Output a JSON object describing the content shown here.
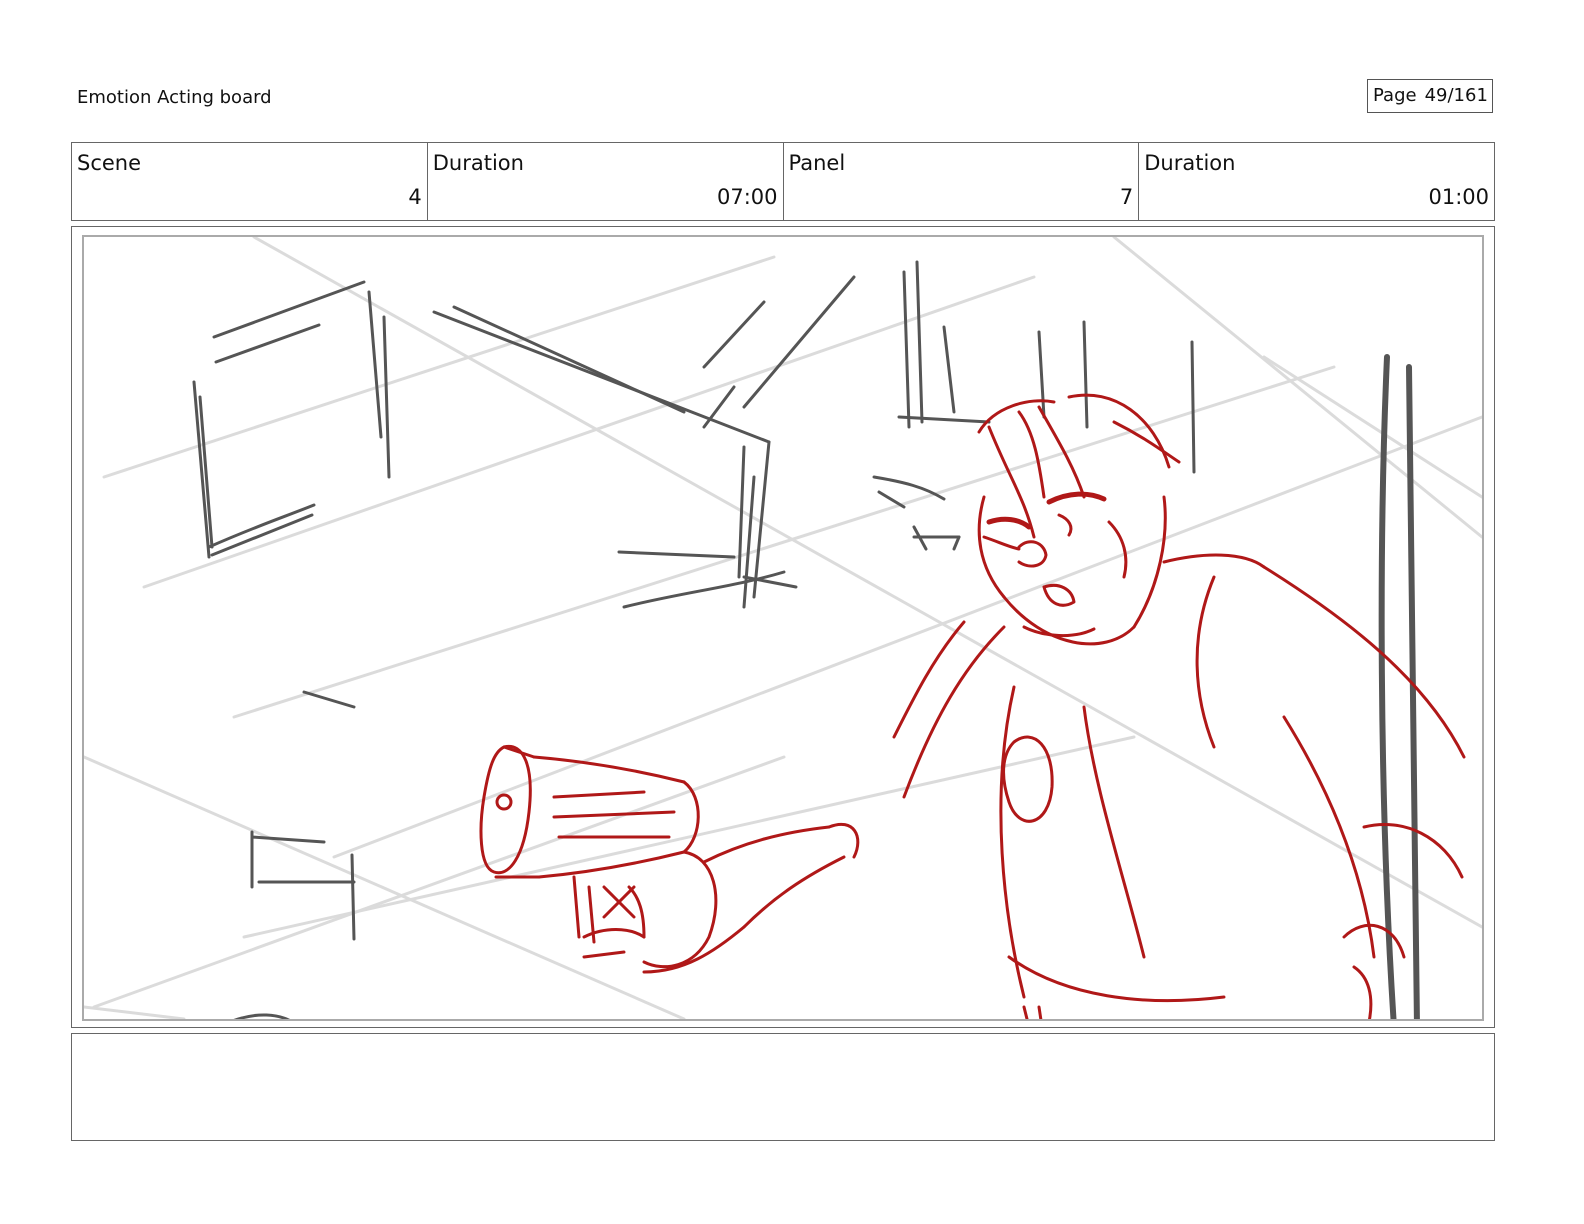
{
  "header": {
    "title": "Emotion Acting board",
    "page_label": "Page",
    "page_number": "49/161"
  },
  "info": {
    "scene_label": "Scene",
    "scene_value": "4",
    "scene_duration_label": "Duration",
    "scene_duration_value": "07:00",
    "panel_label": "Panel",
    "panel_value": "7",
    "panel_duration_label": "Duration",
    "panel_duration_value": "01:00"
  },
  "notes": {
    "text": ""
  },
  "colors": {
    "figure_sketch": "#b01818",
    "background_sketch": "#555555",
    "perspective_guides": "#d8d8d8"
  }
}
